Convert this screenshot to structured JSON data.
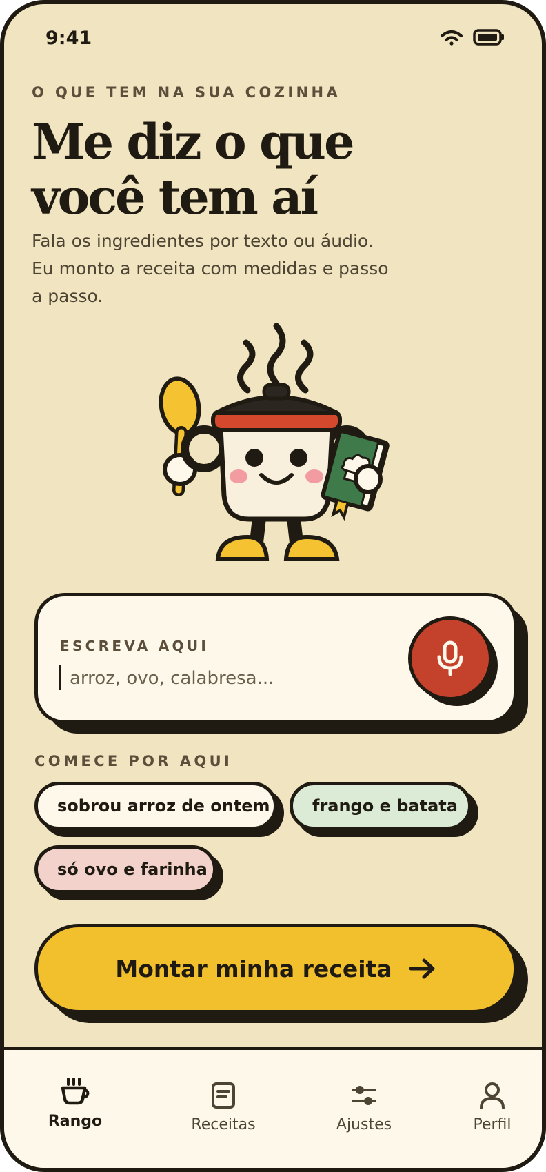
{
  "status_bar": {
    "time": "9:41",
    "wifi_icon": "wifi-icon",
    "battery_icon": "battery-icon"
  },
  "header": {
    "eyebrow": "O QUE TEM NA SUA COZINHA",
    "title_line1": "Me diz o que",
    "title_line2": "você tem aí",
    "subtitle_line1": "Fala os ingredientes por texto ou áudio.",
    "subtitle_line2": "Eu monto a receita com medidas e passo",
    "subtitle_line3": "a passo."
  },
  "mascot": {
    "icon": "cooking-pot-mascot"
  },
  "input": {
    "label": "ESCREVA AQUI",
    "value": "",
    "placeholder": "arroz, ovo, calabresa...",
    "mic_icon": "microphone-icon"
  },
  "suggestions": {
    "label": "COMECE POR AQUI",
    "chips": [
      {
        "label": "sobrou arroz de ontem",
        "color": "#fdf8ea"
      },
      {
        "label": "frango e batata",
        "color": "#dcebd6"
      },
      {
        "label": "só ovo e farinha",
        "color": "#f2d2ca"
      }
    ]
  },
  "cta": {
    "label": "Montar minha receita",
    "icon": "arrow-right-icon",
    "color": "#f3c02d"
  },
  "nav": {
    "items": [
      {
        "label": "Rango",
        "icon": "coffee-cup-icon",
        "active": true
      },
      {
        "label": "Receitas",
        "icon": "document-icon",
        "active": false
      },
      {
        "label": "Ajustes",
        "icon": "sliders-icon",
        "active": false
      },
      {
        "label": "Perfil",
        "icon": "user-icon",
        "active": false
      }
    ]
  },
  "colors": {
    "background": "#f1e4c0",
    "ink": "#1f1a12",
    "accent_red": "#c4422b",
    "accent_yellow": "#f3c02d",
    "card": "#fdf8ea"
  }
}
